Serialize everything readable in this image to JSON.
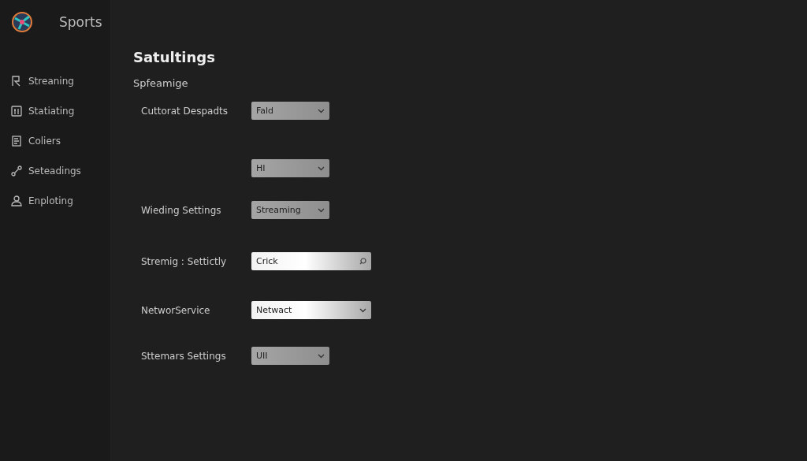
{
  "app": {
    "name": "Sports"
  },
  "sidebar": {
    "items": [
      {
        "label": "Streaning"
      },
      {
        "label": "Statiating"
      },
      {
        "label": "Coliers"
      },
      {
        "label": "Seteadings"
      },
      {
        "label": "Enploting"
      }
    ]
  },
  "page": {
    "title": "Satultings",
    "section": "Spfeamige"
  },
  "settings": [
    {
      "label": "Cuttorat Despadts",
      "kind": "select",
      "wide": false,
      "value": "Fald"
    },
    {
      "kind": "select",
      "wide": false,
      "value": "HI"
    },
    {
      "label": "Wieding  Settings",
      "kind": "select",
      "wide": false,
      "value": "Streaming"
    },
    {
      "label": "Stremig : Settictly",
      "kind": "search",
      "wide": true,
      "value": "Crick"
    },
    {
      "label": "NetworService",
      "kind": "select",
      "wide": true,
      "value": "Netwact"
    },
    {
      "label": "Sttemars Settings",
      "kind": "select",
      "wide": false,
      "value": "UII"
    }
  ]
}
